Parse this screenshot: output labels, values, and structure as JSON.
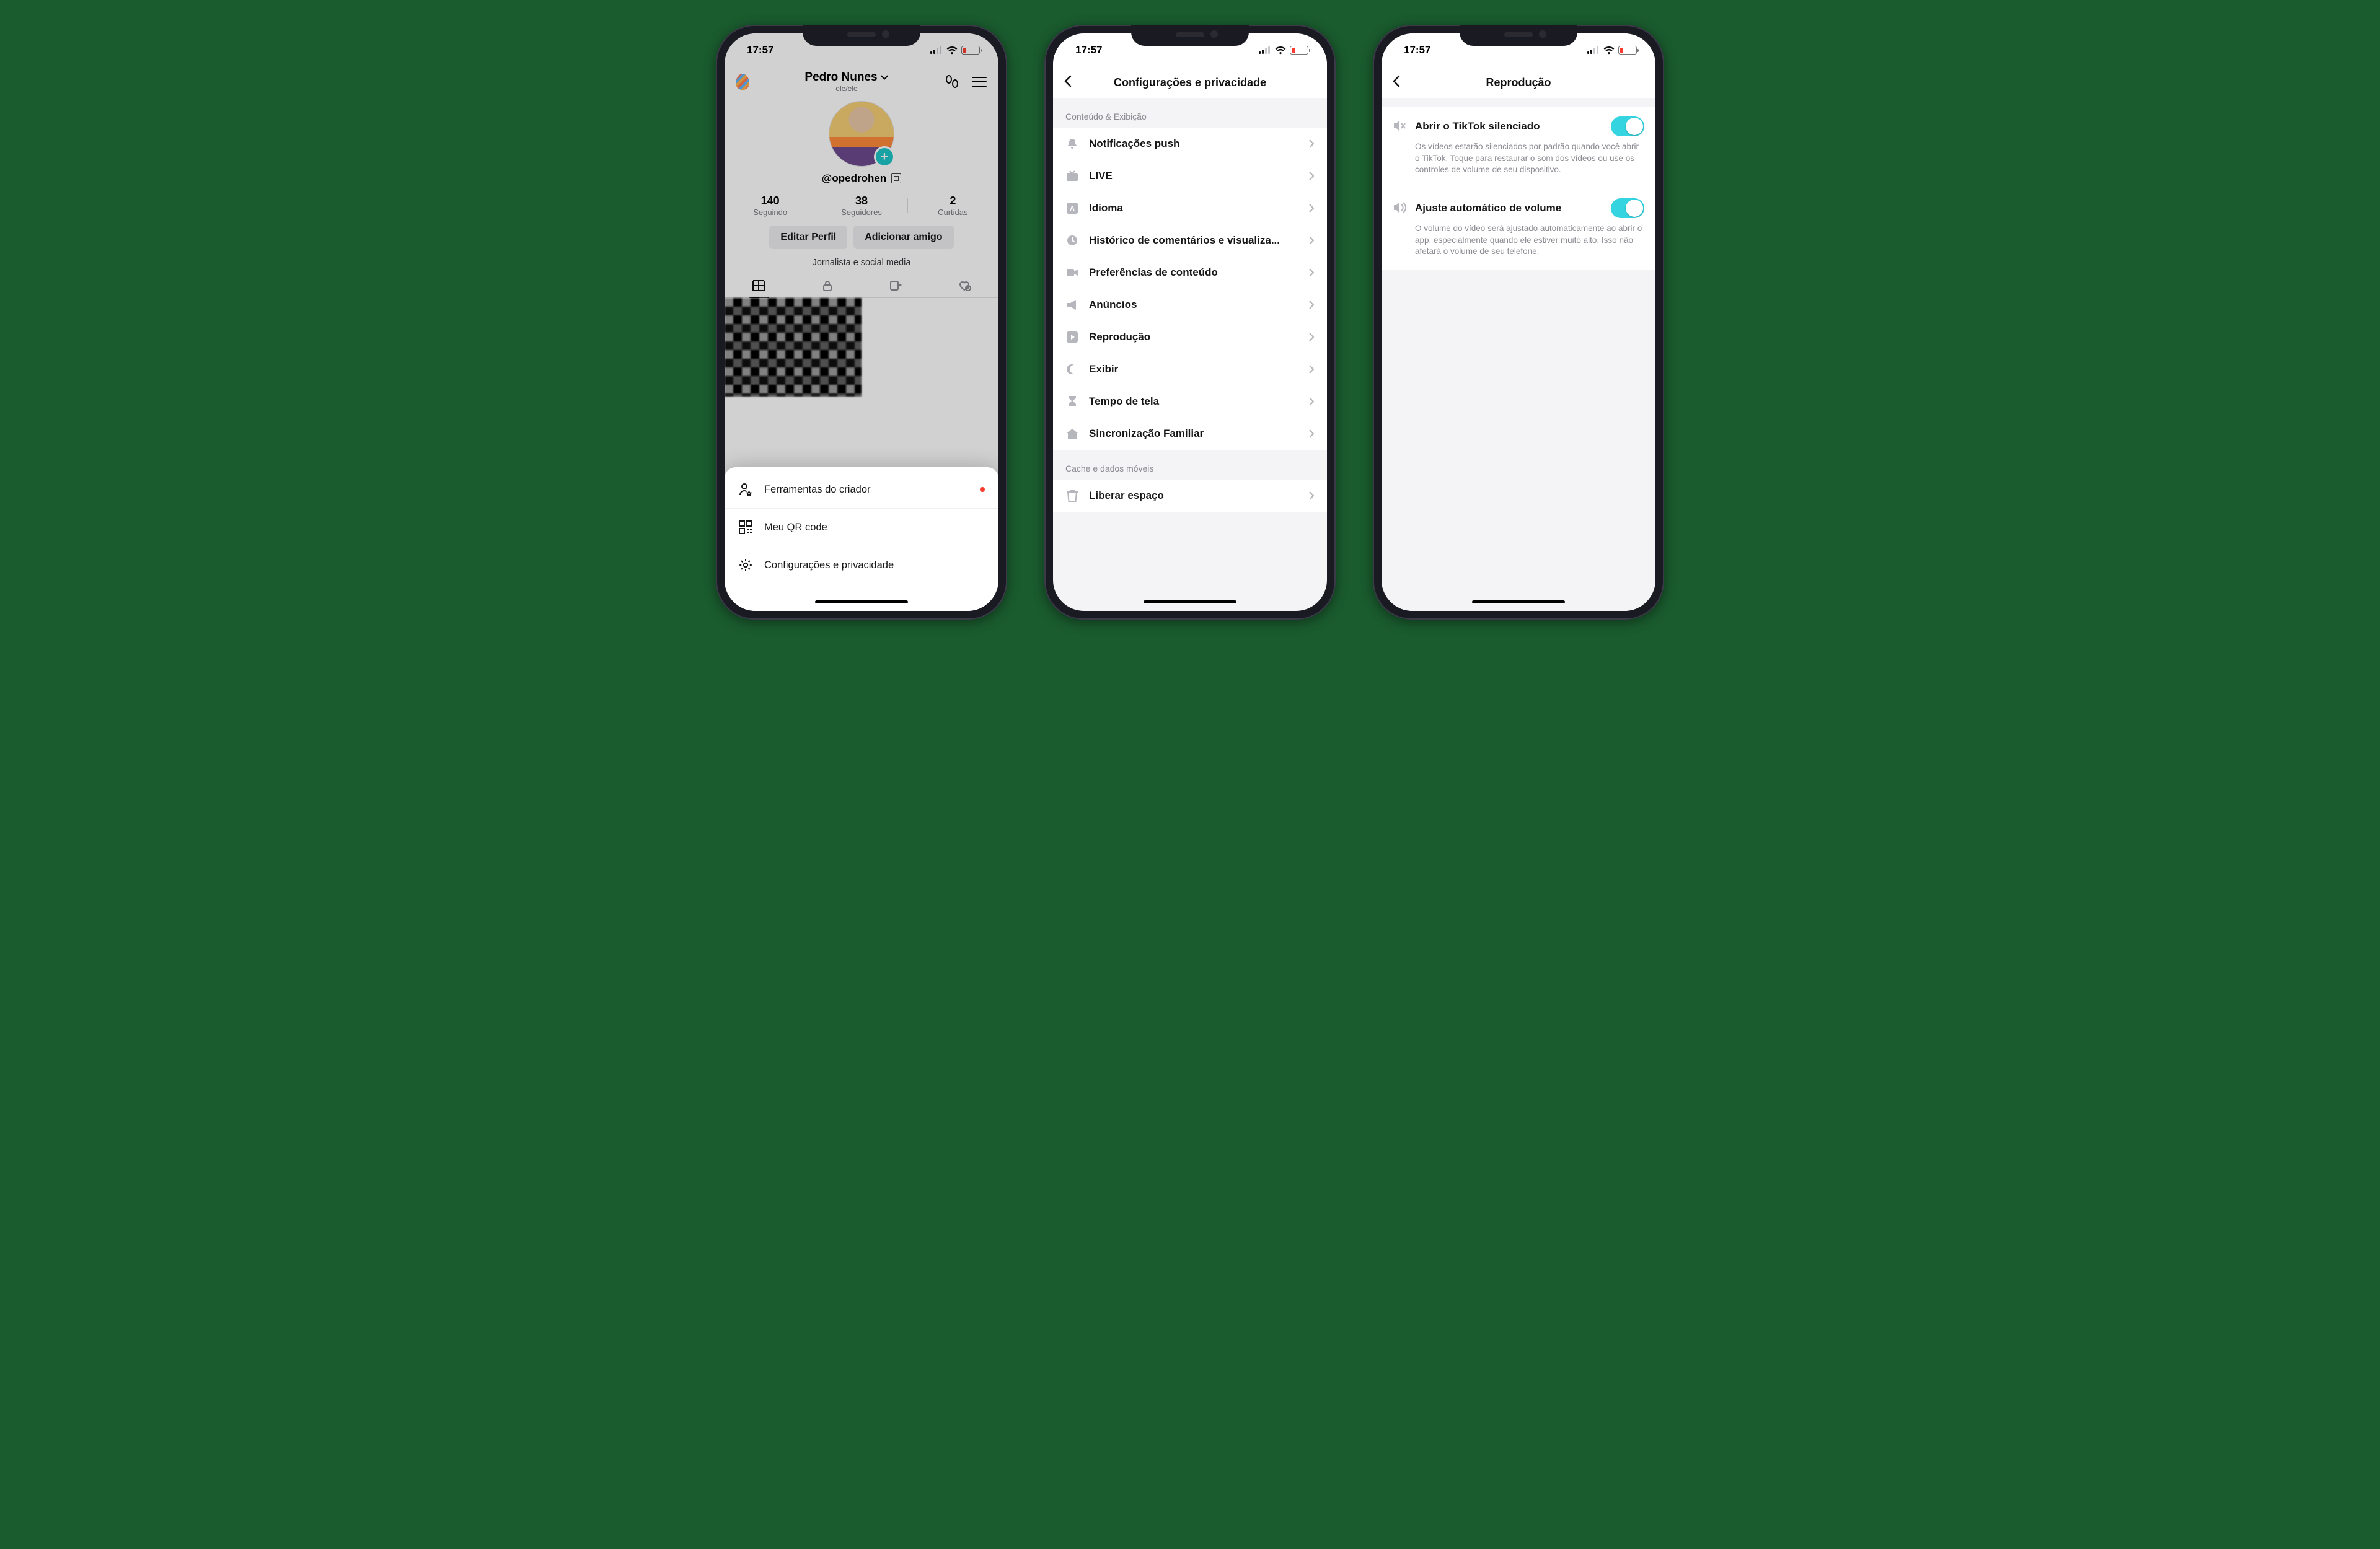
{
  "status": {
    "time": "17:57",
    "battery_percent": "16"
  },
  "phone1": {
    "profile_name": "Pedro Nunes",
    "pronouns": "ele/ele",
    "handle": "@opedrohen",
    "stats": {
      "following_n": "140",
      "following_l": "Seguindo",
      "followers_n": "38",
      "followers_l": "Seguidores",
      "likes_n": "2",
      "likes_l": "Curtidas"
    },
    "edit_btn": "Editar Perfil",
    "add_friend_btn": "Adicionar amigo",
    "bio": "Jornalista e social media",
    "sheet": {
      "creator_tools": "Ferramentas do criador",
      "qr": "Meu QR code",
      "settings": "Configurações e privacidade"
    }
  },
  "phone2": {
    "title": "Configurações e privacidade",
    "section1": "Conteúdo & Exibição",
    "items": [
      "Notificações push",
      "LIVE",
      "Idioma",
      "Histórico de comentários e visualiza...",
      "Preferências de conteúdo",
      "Anúncios",
      "Reprodução",
      "Exibir",
      "Tempo de tela",
      "Sincronização Familiar"
    ],
    "section2": "Cache e dados móveis",
    "free_space": "Liberar espaço"
  },
  "phone3": {
    "title": "Reprodução",
    "mute_label": "Abrir o TikTok silenciado",
    "mute_desc": "Os vídeos estarão silenciados por padrão quando você abrir o TikTok. Toque para restaurar o som dos vídeos ou use os controles de volume de seu dispositivo.",
    "auto_label": "Ajuste automático de volume",
    "auto_desc": "O volume do vídeo será ajustado automaticamente ao abrir o app, especialmente quando ele estiver muito alto. Isso não afetará o volume de seu telefone."
  }
}
